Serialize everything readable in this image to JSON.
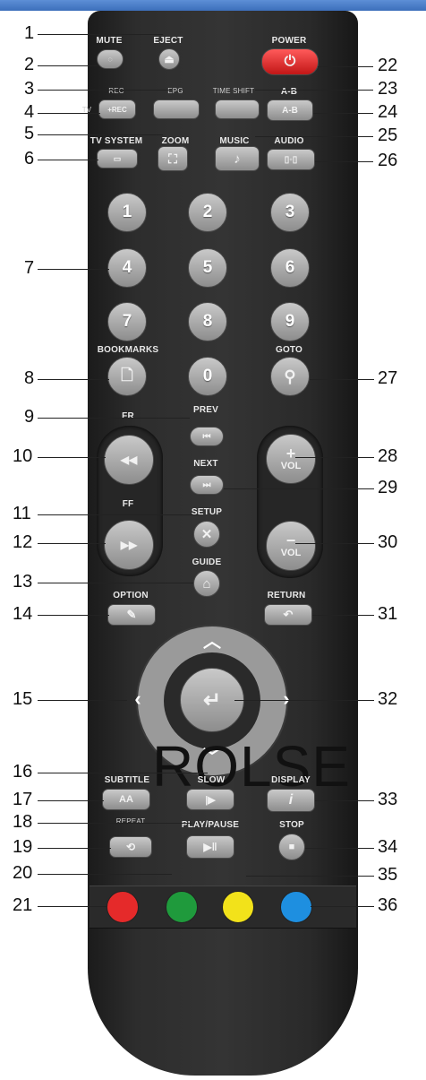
{
  "labels": {
    "mute": "MUTE",
    "eject": "EJECT",
    "power": "POWER",
    "rec": "REC",
    "epg": "EPG",
    "timeshift": "TIME SHIFT",
    "ab": "A-B",
    "tvsystem": "TV SYSTEM",
    "zoom": "ZOOM",
    "music": "MUSIC",
    "audio": "AUDIO",
    "bookmarks": "BOOKMARKS",
    "goto": "GOTO",
    "fr": "FR",
    "prev": "PREV",
    "next": "NEXT",
    "ff": "FF",
    "setup": "SETUP",
    "guide": "GUIDE",
    "option": "OPTION",
    "return": "RETURN",
    "subtitle": "SUBTITLE",
    "slow": "SLOW",
    "display": "DISPLAY",
    "repeat": "REPEAT",
    "playpause": "PLAY/PAUSE",
    "stop": "STOP",
    "vol": "VOL",
    "ab_btn": "A-B",
    "rec_btn": "+REC",
    "tv_small": "TV",
    "aa": "AA"
  },
  "digits": [
    "1",
    "2",
    "3",
    "4",
    "5",
    "6",
    "7",
    "8",
    "9",
    "0"
  ],
  "callouts": {
    "left": [
      "1",
      "2",
      "3",
      "4",
      "5",
      "6",
      "7",
      "8",
      "9",
      "10",
      "11",
      "12",
      "13",
      "14",
      "15",
      "16",
      "17",
      "18",
      "19",
      "20",
      "21"
    ],
    "right": [
      "22",
      "23",
      "24",
      "25",
      "26",
      "27",
      "28",
      "29",
      "30",
      "31",
      "32",
      "33",
      "34",
      "35",
      "36"
    ]
  },
  "watermark": "ROLSE",
  "colors": {
    "red": "#e52a2a",
    "green": "#1f9a3c",
    "yellow": "#f2e21a",
    "blue": "#1e8fe0",
    "power": "#e02424"
  }
}
